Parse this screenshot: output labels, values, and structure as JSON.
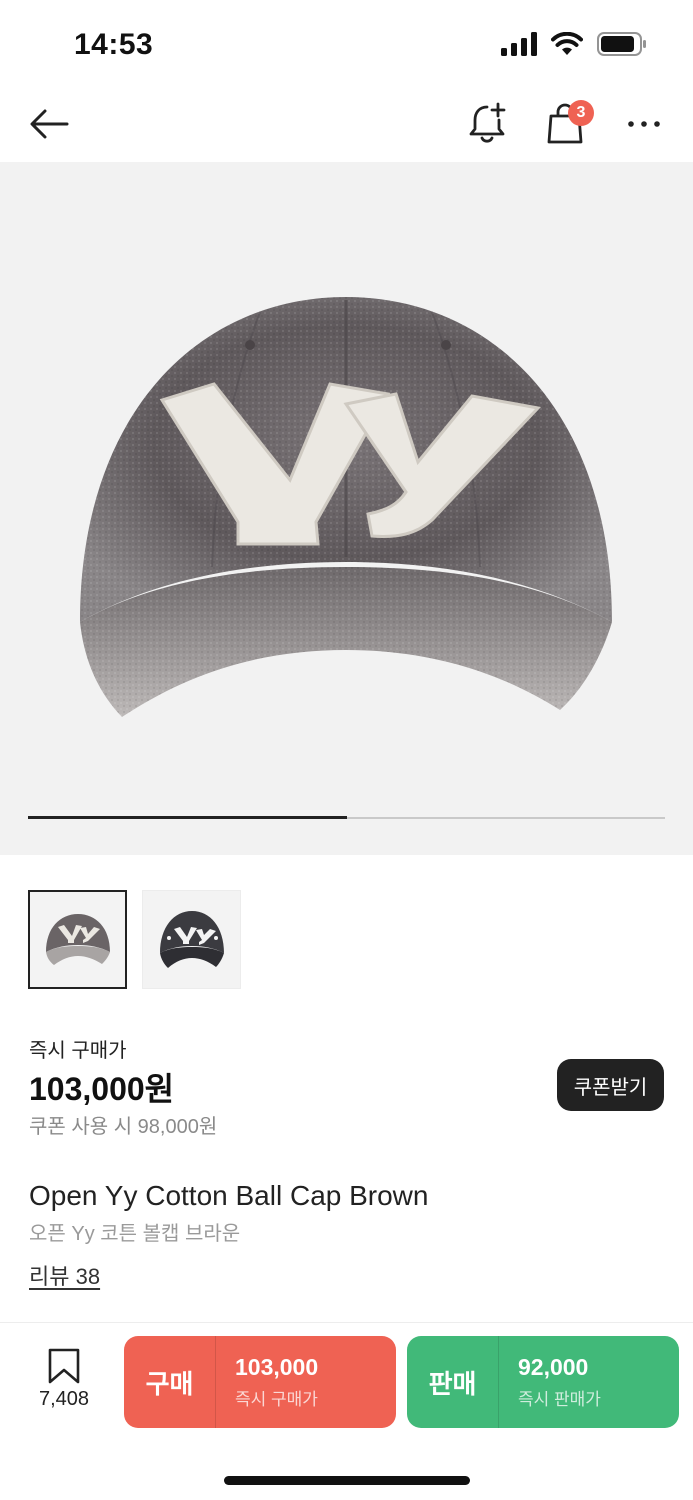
{
  "status_bar": {
    "time": "14:53"
  },
  "header": {
    "back_icon": "arrow-left-icon",
    "notify_icon": "bell-plus-icon",
    "bag_icon": "shopping-bag-icon",
    "bag_badge": "3",
    "more_icon": "more-horizontal-icon"
  },
  "product": {
    "logo_text": "Yy",
    "image_count": 2,
    "image_index": 1,
    "thumbnails": [
      {
        "color": "washed-gray",
        "selected": true
      },
      {
        "color": "charcoal",
        "selected": false
      }
    ],
    "price_label": "즉시 구매가",
    "price": "103,000원",
    "coupon_price": "쿠폰 사용 시 98,000원",
    "coupon_button": "쿠폰받기",
    "title_en": "Open Yy Cotton Ball Cap Brown",
    "title_ko": "오픈 Yy 코튼 볼캡 브라운",
    "review_link": "리뷰 38"
  },
  "bottom_bar": {
    "wish_icon": "bookmark-icon",
    "wish_count": "7,408",
    "buy": {
      "label": "구매",
      "price": "103,000",
      "sub": "즉시 구매가",
      "color": "#ef6253"
    },
    "sell": {
      "label": "판매",
      "price": "92,000",
      "sub": "즉시 판매가",
      "color": "#41b979"
    }
  }
}
